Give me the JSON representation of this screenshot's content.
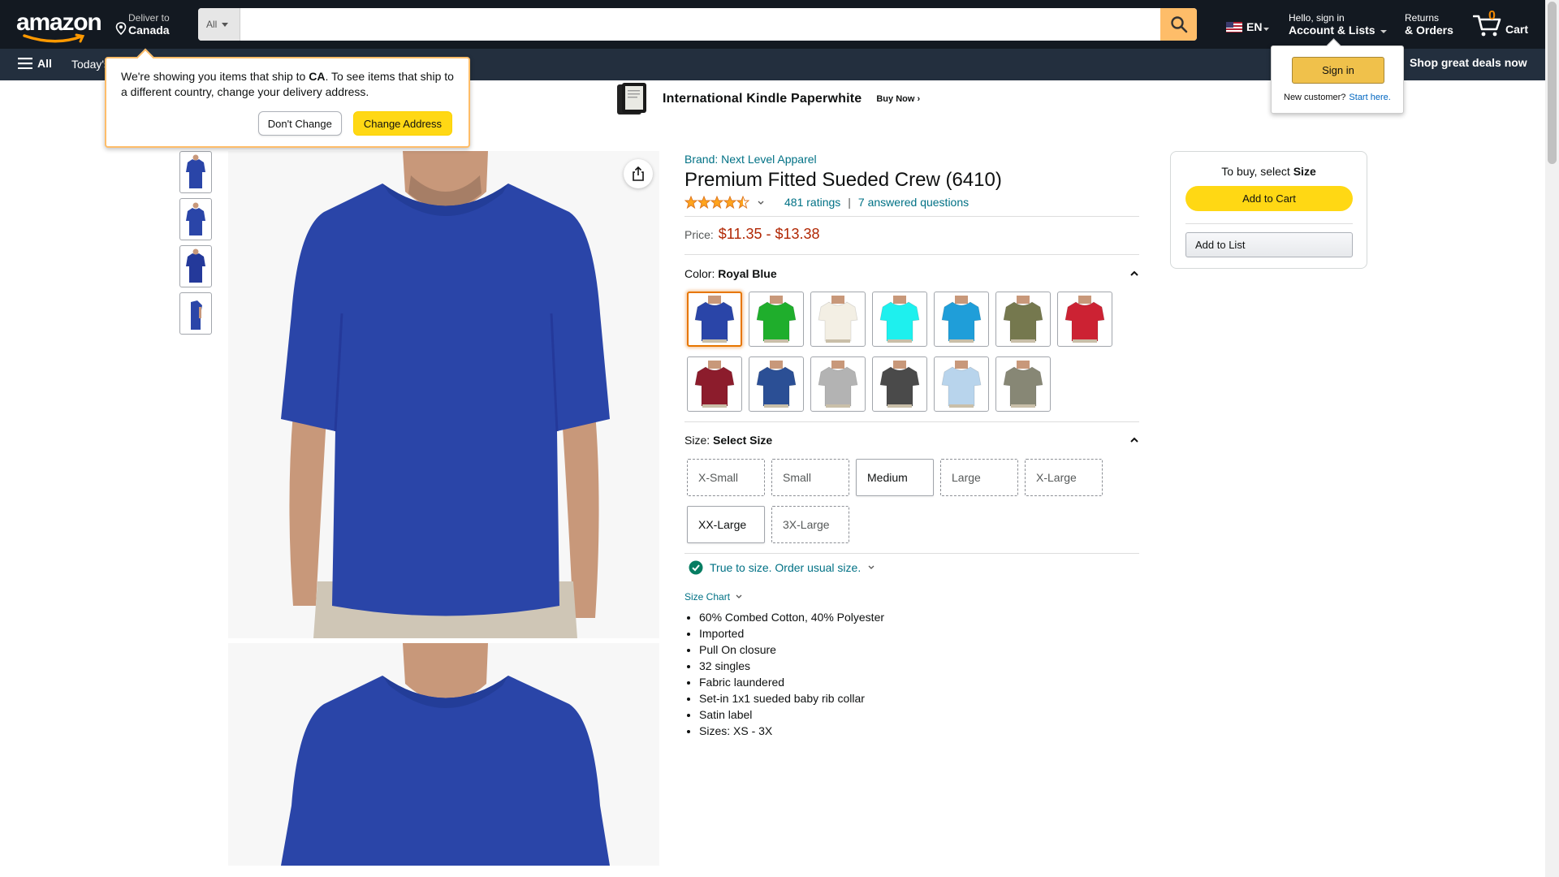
{
  "nav": {
    "logo": "amazon",
    "deliver_to": "Deliver to",
    "deliver_country": "Canada",
    "search_category": "All",
    "search_placeholder": "",
    "language": "EN",
    "account_greeting": "Hello, sign in",
    "account_label": "Account & Lists",
    "returns_l1": "Returns",
    "returns_l2": "& Orders",
    "cart_count": "0",
    "cart_label": "Cart"
  },
  "subnav": {
    "all_label": "All",
    "today_link": "Today's",
    "deals_link": "Shop great deals now"
  },
  "banner": {
    "title": "International Kindle Paperwhite",
    "cta": "Buy Now ›"
  },
  "ship_popover": {
    "text_before": "We're showing you items that ship to ",
    "country": "CA",
    "text_after": ". To see items that ship to a different country, change your delivery address.",
    "dont_change": "Don't Change",
    "change_address": "Change Address"
  },
  "signin_popover": {
    "button": "Sign in",
    "new_customer": "New customer?",
    "start_here": "Start here."
  },
  "product": {
    "brand": "Brand: Next Level Apparel",
    "title": "Premium Fitted Sueded Crew (6410)",
    "rating_stars": 4.5,
    "ratings_count": "481 ratings",
    "questions": "7 answered questions",
    "price_label": "Price:",
    "price_range": "$11.35 - $13.38",
    "color_label": "Color:",
    "color_selected": "Royal Blue",
    "colors": [
      "#2a45a8",
      "#1fae2c",
      "#f3efe4",
      "#1ef0ee",
      "#1f9ed9",
      "#75784e",
      "#cc2233",
      "#8c1c2c",
      "#2b4f95",
      "#b3b3b3",
      "#4a4a4a",
      "#b8d4ec",
      "#878775"
    ],
    "size_label": "Size:",
    "size_selected": "Select Size",
    "sizes": [
      {
        "label": "X-Small",
        "available": false
      },
      {
        "label": "Small",
        "available": false
      },
      {
        "label": "Medium",
        "available": true
      },
      {
        "label": "Large",
        "available": false
      },
      {
        "label": "X-Large",
        "available": false
      },
      {
        "label": "XX-Large",
        "available": true
      },
      {
        "label": "3X-Large",
        "available": false
      }
    ],
    "fit_message": "True to size. Order usual size.",
    "size_chart": "Size Chart",
    "bullets": [
      "60% Combed Cotton, 40% Polyester",
      "Imported",
      "Pull On closure",
      "32 singles",
      "Fabric laundered",
      "Set-in 1x1 sueded baby rib collar",
      "Satin label",
      "Sizes: XS - 3X"
    ]
  },
  "buybox": {
    "prompt_prefix": "To buy, select ",
    "prompt_bold": "Size",
    "add_to_cart": "Add to Cart",
    "add_to_list": "Add to List"
  },
  "colors": {
    "nav_bg": "#131921",
    "subnav_bg": "#232f3e",
    "price": "#b12704",
    "link": "#007185",
    "cart_button": "#ffd814",
    "search_button": "#febd69"
  }
}
